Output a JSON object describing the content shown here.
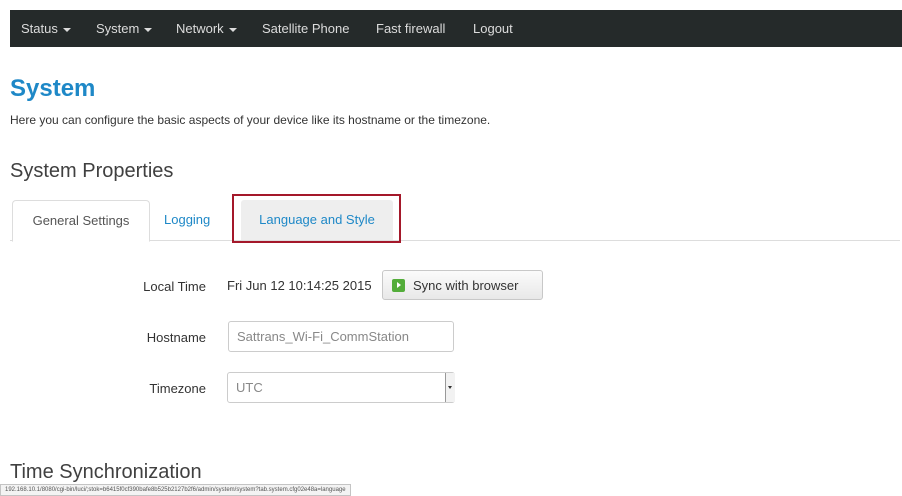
{
  "nav": {
    "items": [
      {
        "label": "Status",
        "dropdown": true
      },
      {
        "label": "System",
        "dropdown": true
      },
      {
        "label": "Network",
        "dropdown": true
      },
      {
        "label": "Satellite Phone",
        "dropdown": false
      },
      {
        "label": "Fast firewall",
        "dropdown": false
      },
      {
        "label": "Logout",
        "dropdown": false
      }
    ]
  },
  "page": {
    "title": "System",
    "description": "Here you can configure the basic aspects of your device like its hostname or the timezone."
  },
  "section": {
    "title": "System Properties",
    "tabs": [
      {
        "label": "General Settings",
        "active": true
      },
      {
        "label": "Logging",
        "active": false
      },
      {
        "label": "Language and Style",
        "active": false,
        "highlighted": true
      }
    ]
  },
  "form": {
    "local_time_label": "Local Time",
    "local_time_value": "Fri Jun 12 10:14:25 2015",
    "sync_button": "Sync with browser",
    "hostname_label": "Hostname",
    "hostname_value": "Sattrans_Wi-Fi_CommStation",
    "timezone_label": "Timezone",
    "timezone_value": "UTC"
  },
  "next_section_title": "Time Synchronization",
  "status_bar_url": "192.168.10.1/8080/cgi-bin/luci/;stok=b6415f0cf390bafe8b525b2127b2f6/admin/system/system?tab.system.cfg02e48a=language",
  "colors": {
    "navbar_bg": "#252a2a",
    "accent": "#1e88c7",
    "highlight_border": "#a4182a",
    "sync_icon": "#53ad3a"
  }
}
